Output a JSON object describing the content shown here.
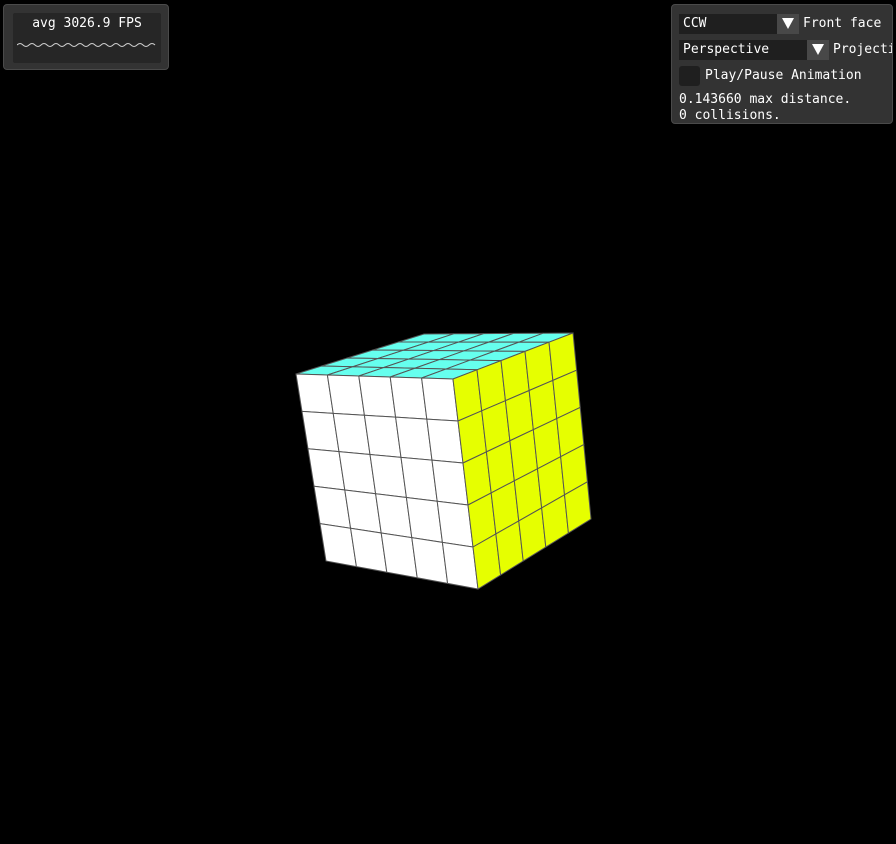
{
  "fps": {
    "text": "avg 3026.9 FPS"
  },
  "controls": {
    "front_face": {
      "value": "CCW",
      "label": "Front face",
      "arrow_icon": "triangle-down-icon"
    },
    "projection": {
      "value": "Perspective",
      "label": "Projection",
      "arrow_icon": "triangle-down-icon"
    },
    "animation": {
      "label": "Play/Pause Animation",
      "checked": false
    },
    "max_distance": "0.143660 max distance.",
    "collisions": "0 collisions."
  },
  "scene": {
    "background": "#000000",
    "cube": {
      "grid": 5,
      "faces": {
        "top": "#66ffee",
        "front": "#ffffff",
        "right": "#e6ff00"
      },
      "grid_line": "#555555"
    }
  }
}
